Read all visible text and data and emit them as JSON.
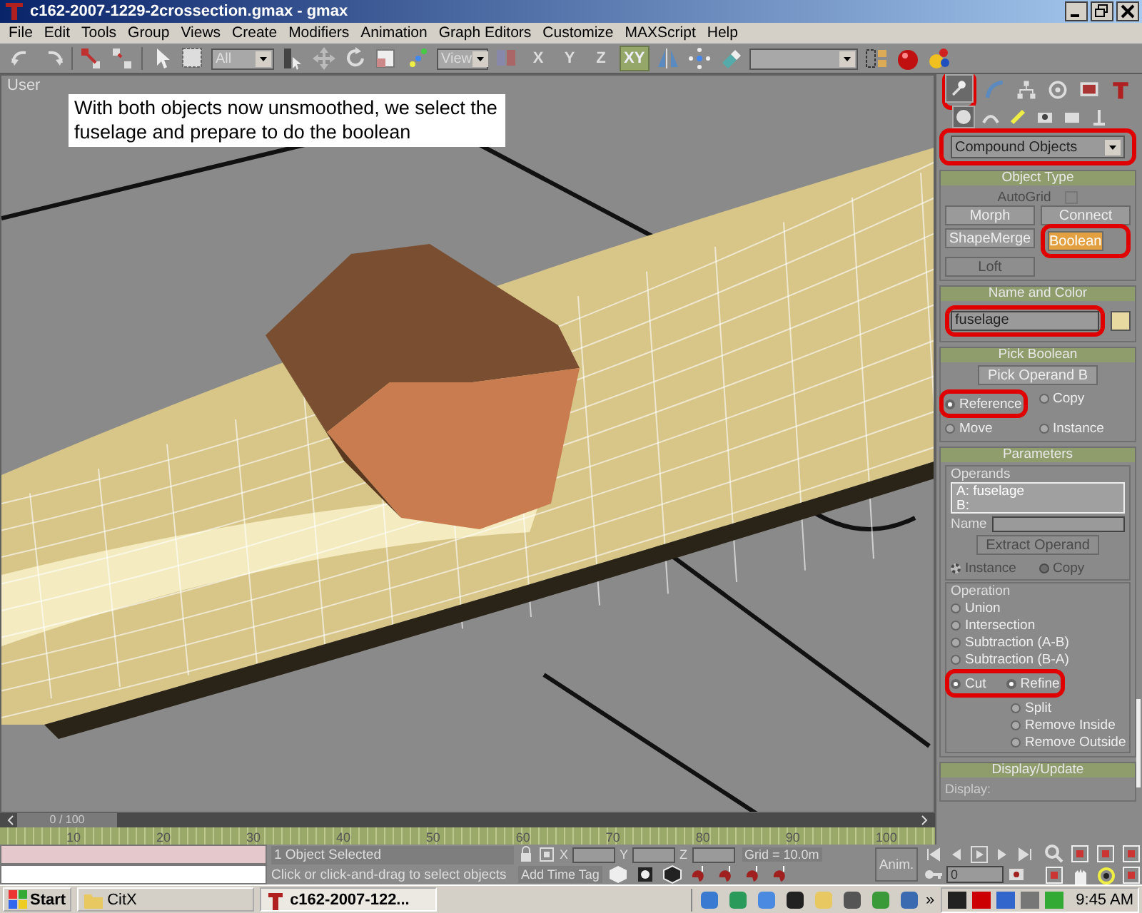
{
  "window": {
    "title": "c162-2007-1229-2crossection.gmax - gmax"
  },
  "menu": [
    "File",
    "Edit",
    "Tools",
    "Group",
    "Views",
    "Create",
    "Modifiers",
    "Animation",
    "Graph Editors",
    "Customize",
    "MAXScript",
    "Help"
  ],
  "toolbar": {
    "selection_filter": "All",
    "reference_coord": "View",
    "axis_buttons": [
      {
        "label": "X",
        "selected": false
      },
      {
        "label": "Y",
        "selected": false
      },
      {
        "label": "Z",
        "selected": false
      },
      {
        "label": "XY",
        "selected": true
      }
    ]
  },
  "viewport": {
    "label": "User",
    "annotation": "With both objects now unsmoothed, we select the fuselage and prepare to do the boolean"
  },
  "command_panel": {
    "tabs": [
      {
        "selected": true
      },
      {
        "selected": false
      },
      {
        "selected": false
      },
      {
        "selected": false
      },
      {
        "selected": false
      },
      {
        "selected": false
      }
    ],
    "categories": [
      {
        "selected": true
      },
      {
        "selected": false
      },
      {
        "selected": false
      },
      {
        "selected": false
      },
      {
        "selected": false
      },
      {
        "selected": false
      }
    ],
    "object_category": "Compound Objects",
    "object_type": {
      "title": "Object Type",
      "autogrid": {
        "label": "AutoGrid",
        "checked": false,
        "disabled": true
      },
      "buttons": [
        {
          "label": "Morph",
          "active": false,
          "disabled": false
        },
        {
          "label": "Connect",
          "active": false,
          "disabled": false
        },
        {
          "label": "ShapeMerge",
          "active": false,
          "disabled": false
        },
        {
          "label": "Boolean",
          "active": true,
          "disabled": false
        },
        {
          "label": "Loft",
          "active": false,
          "disabled": true
        }
      ]
    },
    "name_and_color": {
      "title": "Name and Color",
      "name": "fuselage",
      "color": "#e8d9a0"
    },
    "pick_boolean": {
      "title": "Pick Boolean",
      "button": "Pick Operand B",
      "options": [
        {
          "label": "Reference",
          "selected": true
        },
        {
          "label": "Copy",
          "selected": false
        },
        {
          "label": "Move",
          "selected": false
        },
        {
          "label": "Instance",
          "selected": false
        }
      ]
    },
    "parameters": {
      "title": "Parameters",
      "operands_label": "Operands",
      "operands": [
        "A: fuselage",
        "B:"
      ],
      "name_label": "Name",
      "extract_button": {
        "label": "Extract Operand",
        "disabled": true
      },
      "extract_options": [
        {
          "label": "Instance",
          "selected": true,
          "disabled": true
        },
        {
          "label": "Copy",
          "selected": false,
          "disabled": true
        }
      ],
      "operation_label": "Operation",
      "operations": [
        {
          "label": "Union",
          "selected": false
        },
        {
          "label": "Intersection",
          "selected": false
        },
        {
          "label": "Subtraction (A-B)",
          "selected": false
        },
        {
          "label": "Subtraction (B-A)",
          "selected": false
        },
        {
          "label": "Cut",
          "selected": true
        }
      ],
      "cut_options": [
        {
          "label": "Refine",
          "selected": true
        },
        {
          "label": "Split",
          "selected": false
        },
        {
          "label": "Remove Inside",
          "selected": false
        },
        {
          "label": "Remove Outside",
          "selected": false
        }
      ]
    },
    "display_update": {
      "title": "Display/Update",
      "label": "Display:"
    }
  },
  "time_slider": {
    "label": "0 / 100",
    "level": 0,
    "ticks": [
      "10",
      "20",
      "30",
      "40",
      "50",
      "60",
      "70",
      "80",
      "90",
      "100"
    ]
  },
  "status": {
    "selection": "1 Object Selected",
    "prompt": "Click or click-and-drag to select objects",
    "coords": [
      "X",
      "Y",
      "Z"
    ],
    "grid": "Grid = 10.0m",
    "time_tag": "Add Time Tag",
    "anim_button": "Anim.",
    "frame": "0"
  },
  "taskbar": {
    "start": "Start",
    "tasks": [
      {
        "label": "CitX",
        "selected": false
      },
      {
        "label": "c162-2007-122...",
        "selected": true
      }
    ],
    "more": "»",
    "clock": "9:45 AM"
  }
}
